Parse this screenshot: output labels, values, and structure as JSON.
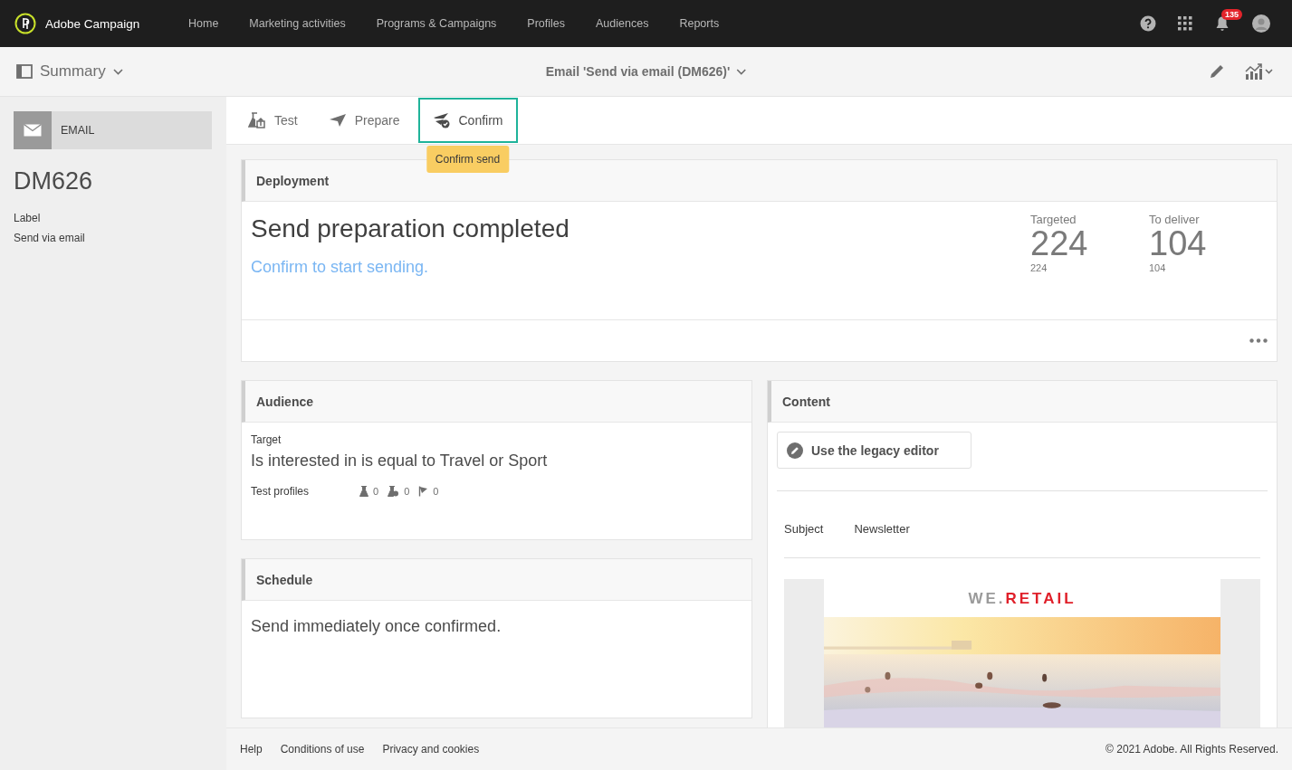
{
  "app": {
    "name": "Adobe Campaign"
  },
  "nav": [
    {
      "label": "Home"
    },
    {
      "label": "Marketing activities"
    },
    {
      "label": "Programs & Campaigns"
    },
    {
      "label": "Profiles"
    },
    {
      "label": "Audiences"
    },
    {
      "label": "Reports"
    }
  ],
  "header": {
    "notification_count": "135"
  },
  "subheader": {
    "summary": "Summary",
    "title": "Email 'Send via email (DM626)'"
  },
  "sidebar": {
    "channel": "EMAIL",
    "name": "DM626",
    "fields": [
      {
        "label": "Label",
        "value": "Send via email"
      }
    ]
  },
  "toolbar": [
    {
      "kind": "test",
      "label": "Test",
      "selected": false
    },
    {
      "kind": "prepare",
      "label": "Prepare",
      "selected": false
    },
    {
      "kind": "confirm",
      "label": "Confirm",
      "selected": true,
      "tooltip": "Confirm send"
    }
  ],
  "deployment": {
    "title": "Deployment",
    "status": "Send preparation completed",
    "link": "Confirm to start sending.",
    "stats": [
      {
        "label": "Targeted",
        "value": "224",
        "sub": "224"
      },
      {
        "label": "To deliver",
        "value": "104",
        "sub": "104"
      }
    ]
  },
  "audience": {
    "title": "Audience",
    "target_label": "Target",
    "target": "Is interested in is equal to Travel or Sport",
    "test_profiles_label": "Test profiles",
    "test_profiles": [
      {
        "kind": "flask",
        "count": "0"
      },
      {
        "kind": "flask-check",
        "count": "0"
      },
      {
        "kind": "flag",
        "count": "0"
      }
    ]
  },
  "schedule": {
    "title": "Schedule",
    "text": "Send immediately once confirmed."
  },
  "content": {
    "title": "Content",
    "editor_button": "Use the legacy editor",
    "subject_label": "Subject",
    "subject": "Newsletter",
    "preview": {
      "logo_prefix": "WE.",
      "logo_name": "RETAIL"
    }
  },
  "footer": {
    "links": [
      {
        "label": "Help"
      },
      {
        "label": "Conditions of use"
      },
      {
        "label": "Privacy and cookies"
      }
    ],
    "copyright": "© 2021 Adobe. All Rights Reserved."
  }
}
